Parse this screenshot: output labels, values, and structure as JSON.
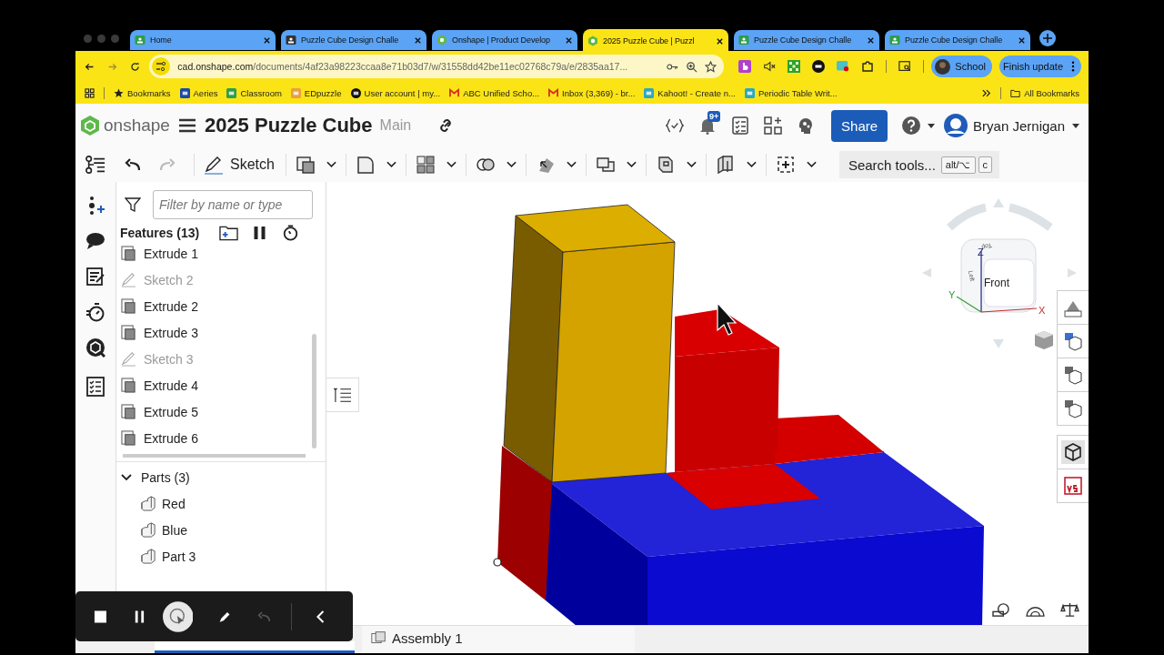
{
  "browser_tabs": [
    {
      "title": "Home",
      "kind": "classroom",
      "selected": false
    },
    {
      "title": "Puzzle Cube Design Challe",
      "kind": "account",
      "selected": false
    },
    {
      "title": "Onshape | Product Develop",
      "kind": "onshape",
      "selected": false
    },
    {
      "title": "2025 Puzzle Cube | Puzzl",
      "kind": "onshape",
      "selected": true
    },
    {
      "title": "Puzzle Cube Design Challe",
      "kind": "classroom",
      "selected": false
    },
    {
      "title": "Puzzle Cube Design Challe",
      "kind": "classroom",
      "selected": false
    }
  ],
  "address_bar": {
    "domain": "cad.onshape.com",
    "path": "/documents/4af23a98223ccaa8e71b03d7/w/31558dd42be11ec02768c79a/e/2835aa17..."
  },
  "profile_button": "School",
  "update_button": "Finish update",
  "bookmarks": [
    {
      "label": "Bookmarks",
      "kind": "star"
    },
    {
      "label": "Aeries",
      "kind": "aeries"
    },
    {
      "label": "Classroom",
      "kind": "classroom"
    },
    {
      "label": "EDpuzzle",
      "kind": "edpuzzle"
    },
    {
      "label": "User account | my...",
      "kind": "account"
    },
    {
      "label": "ABC Unified Scho...",
      "kind": "gmail"
    },
    {
      "label": "Inbox (3,369) - br...",
      "kind": "gmail"
    },
    {
      "label": "Kahoot! - Create n...",
      "kind": "kahoot"
    },
    {
      "label": "Periodic Table Writ...",
      "kind": "periodic"
    }
  ],
  "all_bookmarks": "All Bookmarks",
  "document": {
    "title": "2025 Puzzle Cube",
    "branch": "Main",
    "logo": "onshape"
  },
  "notification_badge": "9+",
  "share_button": "Share",
  "user_name": "Bryan Jernigan",
  "sketch_button": "Sketch",
  "tool_search": {
    "placeholder": "Search tools...",
    "keys": [
      "alt/⌥",
      "c"
    ]
  },
  "filter": {
    "placeholder": "Filter by name or type"
  },
  "features": {
    "title": "Features (13)",
    "items": [
      {
        "label": "Extrude 1",
        "kind": "extrude"
      },
      {
        "label": "Sketch 2",
        "kind": "sketch"
      },
      {
        "label": "Extrude 2",
        "kind": "extrude"
      },
      {
        "label": "Extrude 3",
        "kind": "extrude"
      },
      {
        "label": "Sketch 3",
        "kind": "sketch"
      },
      {
        "label": "Extrude 4",
        "kind": "extrude"
      },
      {
        "label": "Extrude 5",
        "kind": "extrude"
      },
      {
        "label": "Extrude 6",
        "kind": "extrude"
      }
    ]
  },
  "parts": {
    "title": "Parts (3)",
    "expanded": true,
    "items": [
      "Red",
      "Blue",
      "Part 3"
    ]
  },
  "view_cube": {
    "front": "Front",
    "left": "Left",
    "top": "Top",
    "x": "X",
    "y": "Y",
    "z": "Z"
  },
  "bottom_tabs": [
    {
      "label": "Assembly 1",
      "selected": false
    }
  ]
}
